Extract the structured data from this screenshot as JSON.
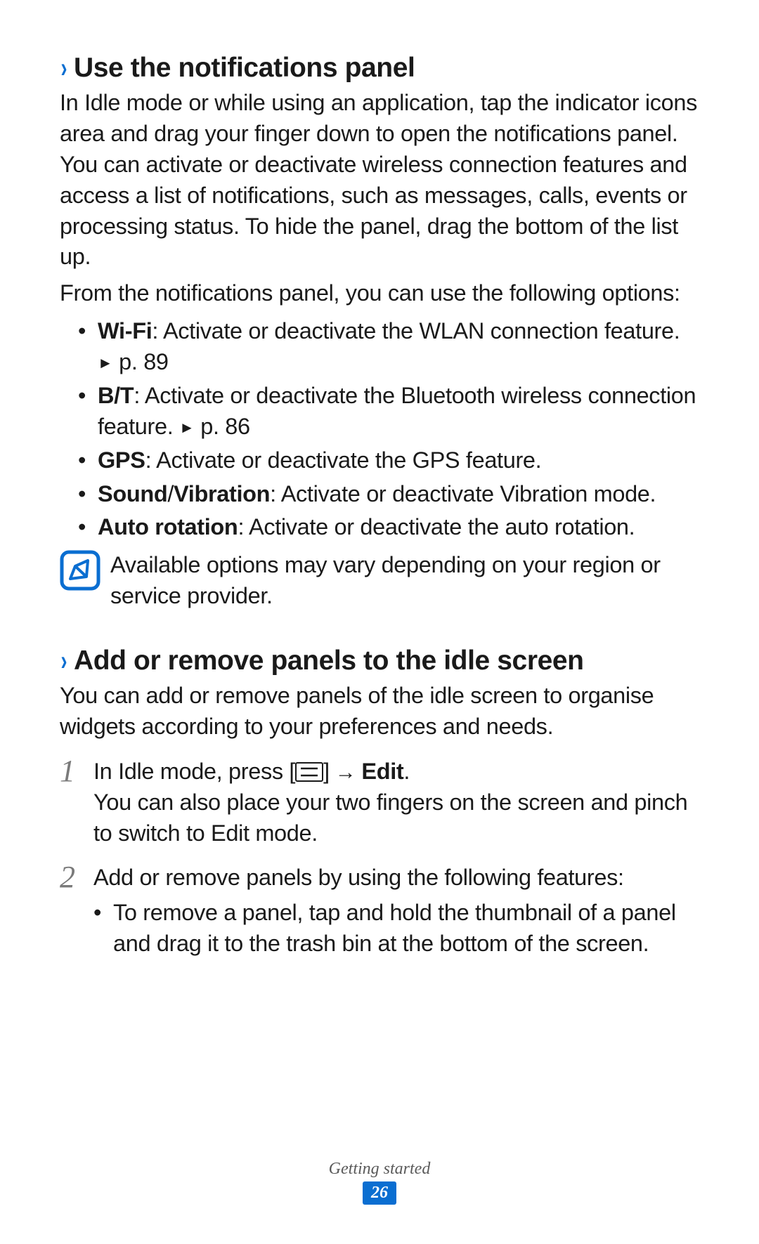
{
  "section1": {
    "title": "Use the notifications panel",
    "intro": "In Idle mode or while using an application, tap the indicator icons area and drag your finger down to open the notifications panel. You can activate or deactivate wireless connection features and access a list of notifications, such as messages, calls, events or processing status. To hide the panel, drag the bottom of the list up.",
    "lead": "From the notifications panel, you can use the following options:",
    "items": {
      "wifi_label": "Wi-Fi",
      "wifi_text": ": Activate or deactivate the WLAN connection feature. ",
      "wifi_ref": "p. 89",
      "bt_label": "B/T",
      "bt_text": ": Activate or deactivate the Bluetooth wireless connection feature. ",
      "bt_ref": "p. 86",
      "gps_label": "GPS",
      "gps_text": ": Activate or deactivate the GPS feature.",
      "sound_label": "Sound",
      "sound_sep": "/",
      "vib_label": "Vibration",
      "sound_text": ": Activate or deactivate Vibration mode.",
      "rot_label": "Auto rotation",
      "rot_text": ": Activate or deactivate the auto rotation."
    },
    "note": "Available options may vary depending on your region or service provider."
  },
  "section2": {
    "title": "Add or remove panels to the idle screen",
    "intro": "You can add or remove panels of the idle screen to organise widgets according to your preferences and needs.",
    "step1_num": "1",
    "step1_prefix": "In Idle mode, press [",
    "step1_arrow": " → ",
    "step1_edit": "Edit",
    "step1_after": ".",
    "step1_bracket_close": "]",
    "step1_body2": "You can also place your two fingers on the screen and pinch to switch to Edit mode.",
    "step2_num": "2",
    "step2_lead": "Add or remove panels by using the following features:",
    "step2_bullet": "To remove a panel, tap and hold the thumbnail of a panel and drag it to the trash bin at the bottom of the screen."
  },
  "footer": {
    "section": "Getting started",
    "page": "26"
  },
  "glyphs": {
    "chevron": "›",
    "triangle": "►"
  }
}
